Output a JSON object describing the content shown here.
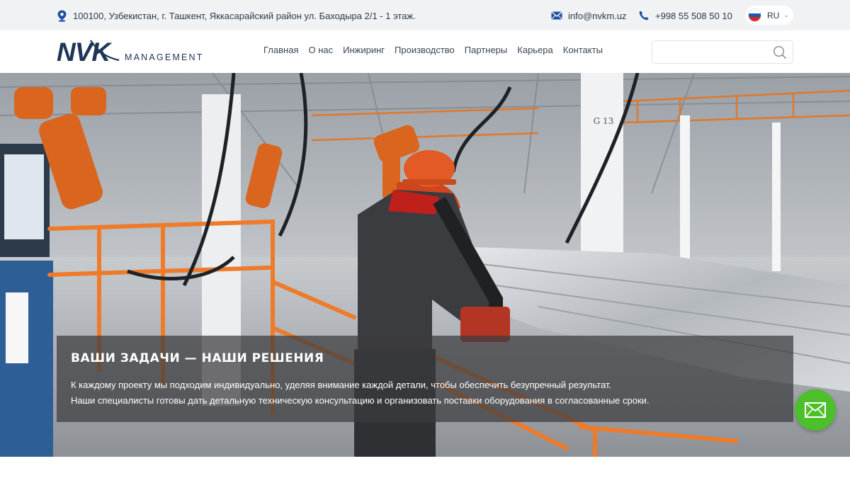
{
  "topbar": {
    "address": "100100, Узбекистан, г. Ташкент, Яккасарайский район ул. Баходыра 2/1 - 1 этаж.",
    "email": "info@nvkm.uz",
    "phone": "+998 55 508 50 10",
    "language": "RU",
    "icons": {
      "address": "location-pin-icon",
      "email": "envelope-icon",
      "phone": "phone-icon",
      "language": "russia-flag-icon"
    }
  },
  "header": {
    "logo_text": "NVK",
    "logo_sub": "MANAGEMENT",
    "nav": [
      "Главная",
      "О нас",
      "Инжиринг",
      "Производство",
      "Партнеры",
      "Карьера",
      "Контакты"
    ],
    "search_placeholder": ""
  },
  "hero": {
    "title": "ВАШИ ЗАДАЧИ — НАШИ РЕШЕНИЯ",
    "line1": "К каждому проекту мы подходим индивидуально, уделяя внимание каждой детали, чтобы обеспечить безупречный результат.",
    "line2": "Наши специалисты готовы дать детальную техническую консультацию и организовать поставки оборудования в согласованные сроки.",
    "scene_label": "G 13"
  },
  "colors": {
    "brand_navy": "#1d3557",
    "accent_blue": "#1e4fa0",
    "fab_green": "#4cbf2a",
    "topbar_bg": "#f1f2f4",
    "caption_bg": "rgba(60,60,62,0.72)"
  }
}
